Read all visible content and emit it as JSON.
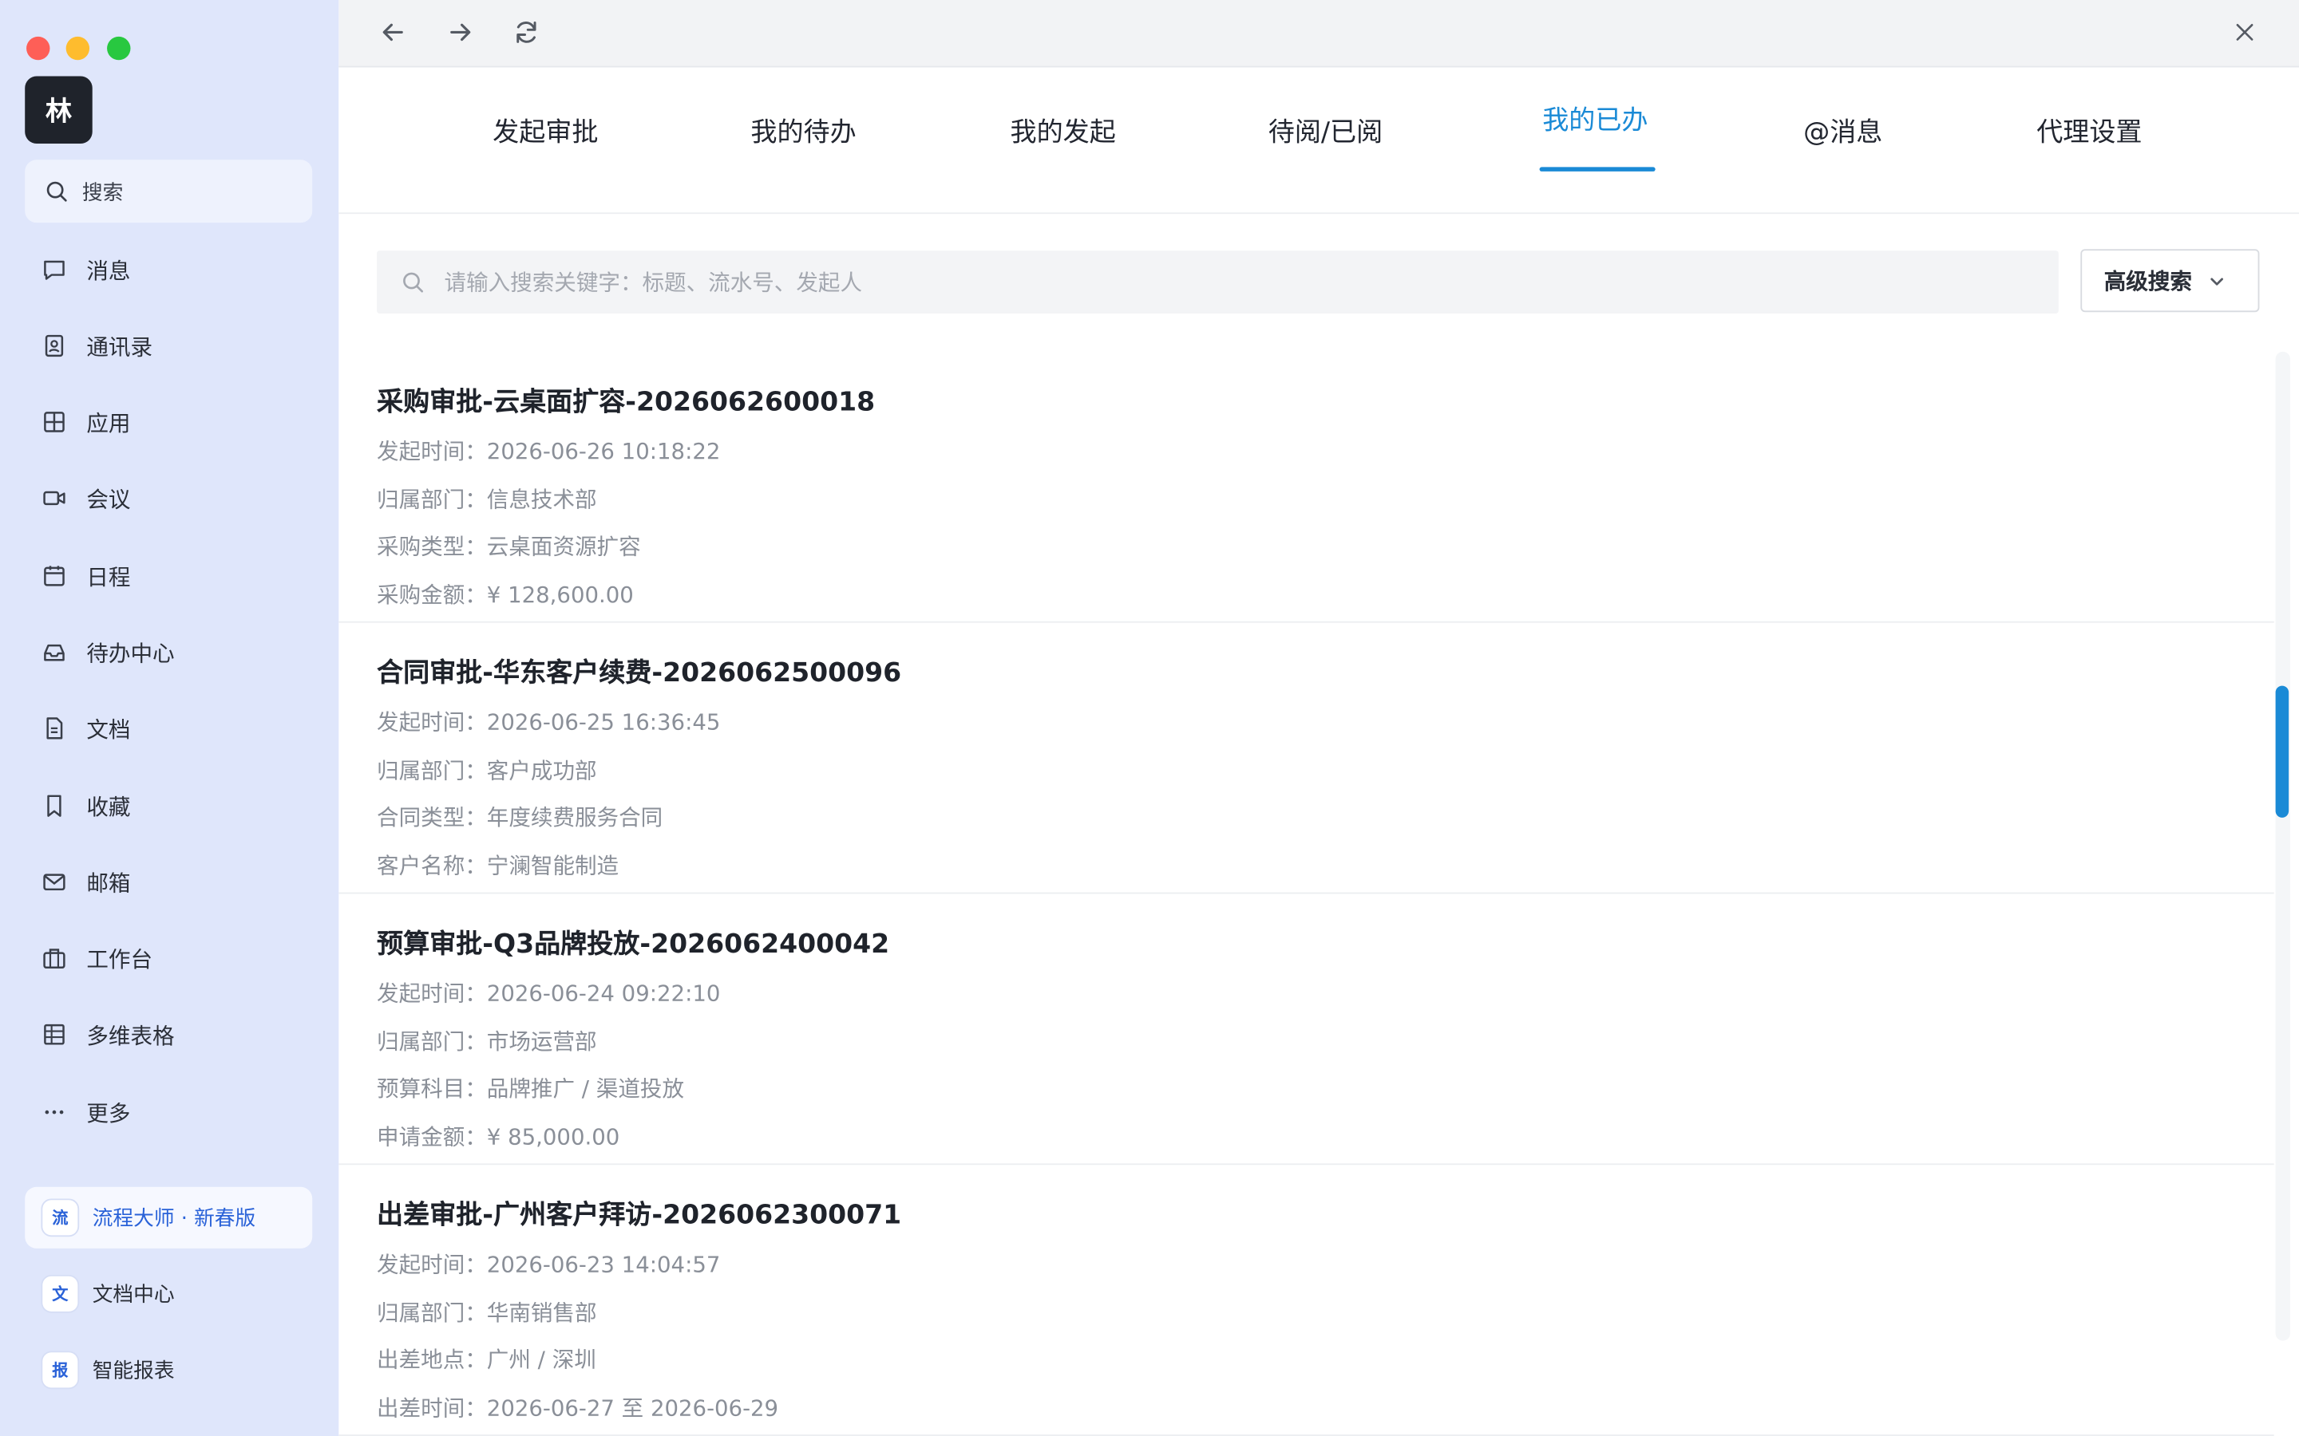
{
  "sidebar": {
    "avatar_text": "林",
    "search_label": "搜索",
    "items": [
      {
        "label": "消息",
        "icon": "message-icon"
      },
      {
        "label": "通讯录",
        "icon": "contacts-icon"
      },
      {
        "label": "应用",
        "icon": "apps-icon"
      },
      {
        "label": "会议",
        "icon": "video-icon"
      },
      {
        "label": "日程",
        "icon": "calendar-icon"
      },
      {
        "label": "待办中心",
        "icon": "inbox-icon"
      },
      {
        "label": "文档",
        "icon": "document-icon"
      },
      {
        "label": "收藏",
        "icon": "bookmark-icon"
      },
      {
        "label": "邮箱",
        "icon": "mail-icon"
      },
      {
        "label": "工作台",
        "icon": "briefcase-icon"
      },
      {
        "label": "多维表格",
        "icon": "table-icon"
      },
      {
        "label": "更多",
        "icon": "more-icon"
      }
    ],
    "apps": [
      {
        "badge": "流",
        "label": "流程大师 · 新春版",
        "active": true
      },
      {
        "badge": "文",
        "label": "文档中心",
        "active": false
      },
      {
        "badge": "报",
        "label": "智能报表",
        "active": false
      }
    ]
  },
  "tabs": [
    {
      "label": "发起审批"
    },
    {
      "label": "我的待办"
    },
    {
      "label": "我的发起"
    },
    {
      "label": "待阅/已阅"
    },
    {
      "label": "我的已办",
      "active": true
    },
    {
      "label": "@消息"
    },
    {
      "label": "代理设置"
    }
  ],
  "search": {
    "placeholder": "请输入搜索关键字：标题、流水号、发起人",
    "advanced_label": "高级搜索"
  },
  "records": [
    {
      "title": "采购审批-云桌面扩容-2026062600018",
      "fields": [
        "发起时间：2026-06-26 10:18:22",
        "归属部门：信息技术部",
        "采购类型：云桌面资源扩容",
        "采购金额：¥ 128,600.00"
      ]
    },
    {
      "title": "合同审批-华东客户续费-2026062500096",
      "fields": [
        "发起时间：2026-06-25 16:36:45",
        "归属部门：客户成功部",
        "合同类型：年度续费服务合同",
        "客户名称：宁澜智能制造"
      ]
    },
    {
      "title": "预算审批-Q3品牌投放-2026062400042",
      "fields": [
        "发起时间：2026-06-24 09:22:10",
        "归属部门：市场运营部",
        "预算科目：品牌推广 / 渠道投放",
        "申请金额：¥ 85,000.00"
      ]
    },
    {
      "title": "出差审批-广州客户拜访-2026062300071",
      "fields": [
        "发起时间：2026-06-23 14:04:57",
        "归属部门：华南销售部",
        "出差地点：广州 / 深圳",
        "出差时间：2026-06-27 至 2026-06-29"
      ]
    }
  ],
  "colors": {
    "accent": "#1a8ad6",
    "sidebar_bg": "#dfe6fb"
  }
}
